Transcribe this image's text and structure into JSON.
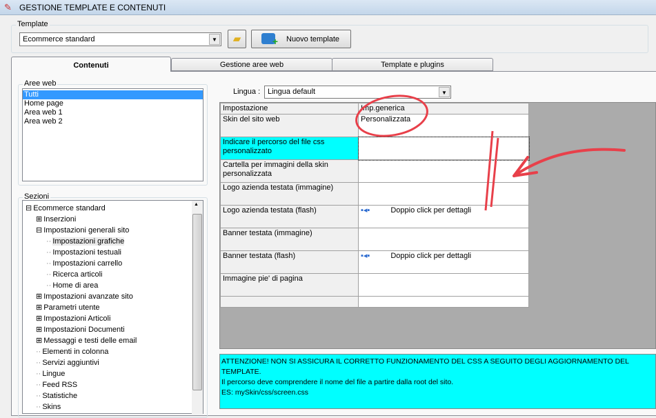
{
  "window": {
    "title": "GESTIONE TEMPLATE E CONTENUTI"
  },
  "template": {
    "group_label": "Template",
    "selected": "Ecommerce standard",
    "new_button": "Nuovo template"
  },
  "tabs": [
    {
      "label": "Contenuti",
      "active": true
    },
    {
      "label": "Gestione aree web"
    },
    {
      "label": "Template e plugins"
    }
  ],
  "aree_web": {
    "label": "Aree web",
    "items": [
      "Tutti",
      "Home page",
      "Area web 1",
      "Area web 2"
    ],
    "selected": "Tutti"
  },
  "sezioni": {
    "label": "Sezioni",
    "tree": [
      {
        "label": "Ecommerce standard",
        "level": 0,
        "exp": "minus"
      },
      {
        "label": "Inserzioni",
        "level": 1,
        "exp": "plus"
      },
      {
        "label": "Impostazioni generali sito",
        "level": 1,
        "exp": "minus"
      },
      {
        "label": "Impostazioni grafiche",
        "level": 2,
        "selected": true
      },
      {
        "label": "Impostazioni testuali",
        "level": 2
      },
      {
        "label": "Impostazioni carrello",
        "level": 2
      },
      {
        "label": "Ricerca articoli",
        "level": 2
      },
      {
        "label": "Home di area",
        "level": 2
      },
      {
        "label": "Impostazioni avanzate sito",
        "level": 1,
        "exp": "plus"
      },
      {
        "label": "Parametri utente",
        "level": 1,
        "exp": "plus"
      },
      {
        "label": "Impostazioni Articoli",
        "level": 1,
        "exp": "plus"
      },
      {
        "label": "Impostazioni Documenti",
        "level": 1,
        "exp": "plus"
      },
      {
        "label": "Messaggi e testi delle email",
        "level": 1,
        "exp": "plus"
      },
      {
        "label": "Elementi in colonna",
        "level": 1
      },
      {
        "label": "Servizi aggiuntivi",
        "level": 1
      },
      {
        "label": "Lingue",
        "level": 1
      },
      {
        "label": "Feed RSS",
        "level": 1
      },
      {
        "label": "Statistiche",
        "level": 1
      },
      {
        "label": "Skins",
        "level": 1
      }
    ]
  },
  "lingua": {
    "label": "Lingua :",
    "selected": "Lingua default"
  },
  "grid": {
    "headers": [
      "Impostazione",
      "Imp.generica"
    ],
    "rows": [
      {
        "key": "Skin del sito web",
        "value": "Personalizzata"
      },
      {
        "key": "Indicare il percorso del file css personalizzato",
        "value": "",
        "highlight": true
      },
      {
        "key": "Cartella per immagini della skin personalizzata",
        "value": ""
      },
      {
        "key": "Logo azienda testata (immagine)",
        "value": ""
      },
      {
        "key": "Logo azienda testata (flash)",
        "value": "Doppio click per dettagli",
        "icon": true
      },
      {
        "key": "Banner testata (immagine)",
        "value": ""
      },
      {
        "key": "Banner testata (flash)",
        "value": "Doppio click per dettagli",
        "icon": true
      },
      {
        "key": "Immagine pie' di pagina",
        "value": ""
      },
      {
        "key": "",
        "value": ""
      }
    ]
  },
  "info": {
    "lines": [
      "ATTENZIONE! NON SI ASSICURA IL CORRETTO FUNZIONAMENTO DEL CSS A SEGUITO DEGLI AGGIORNAMENTO DEL TEMPLATE.",
      "Il percorso deve comprendere il nome del file a partire dalla root del sito.",
      "ES: mySkin/css/screen.css"
    ]
  },
  "colors": {
    "highlight": "#00ffff",
    "annotation": "#e8404a"
  }
}
